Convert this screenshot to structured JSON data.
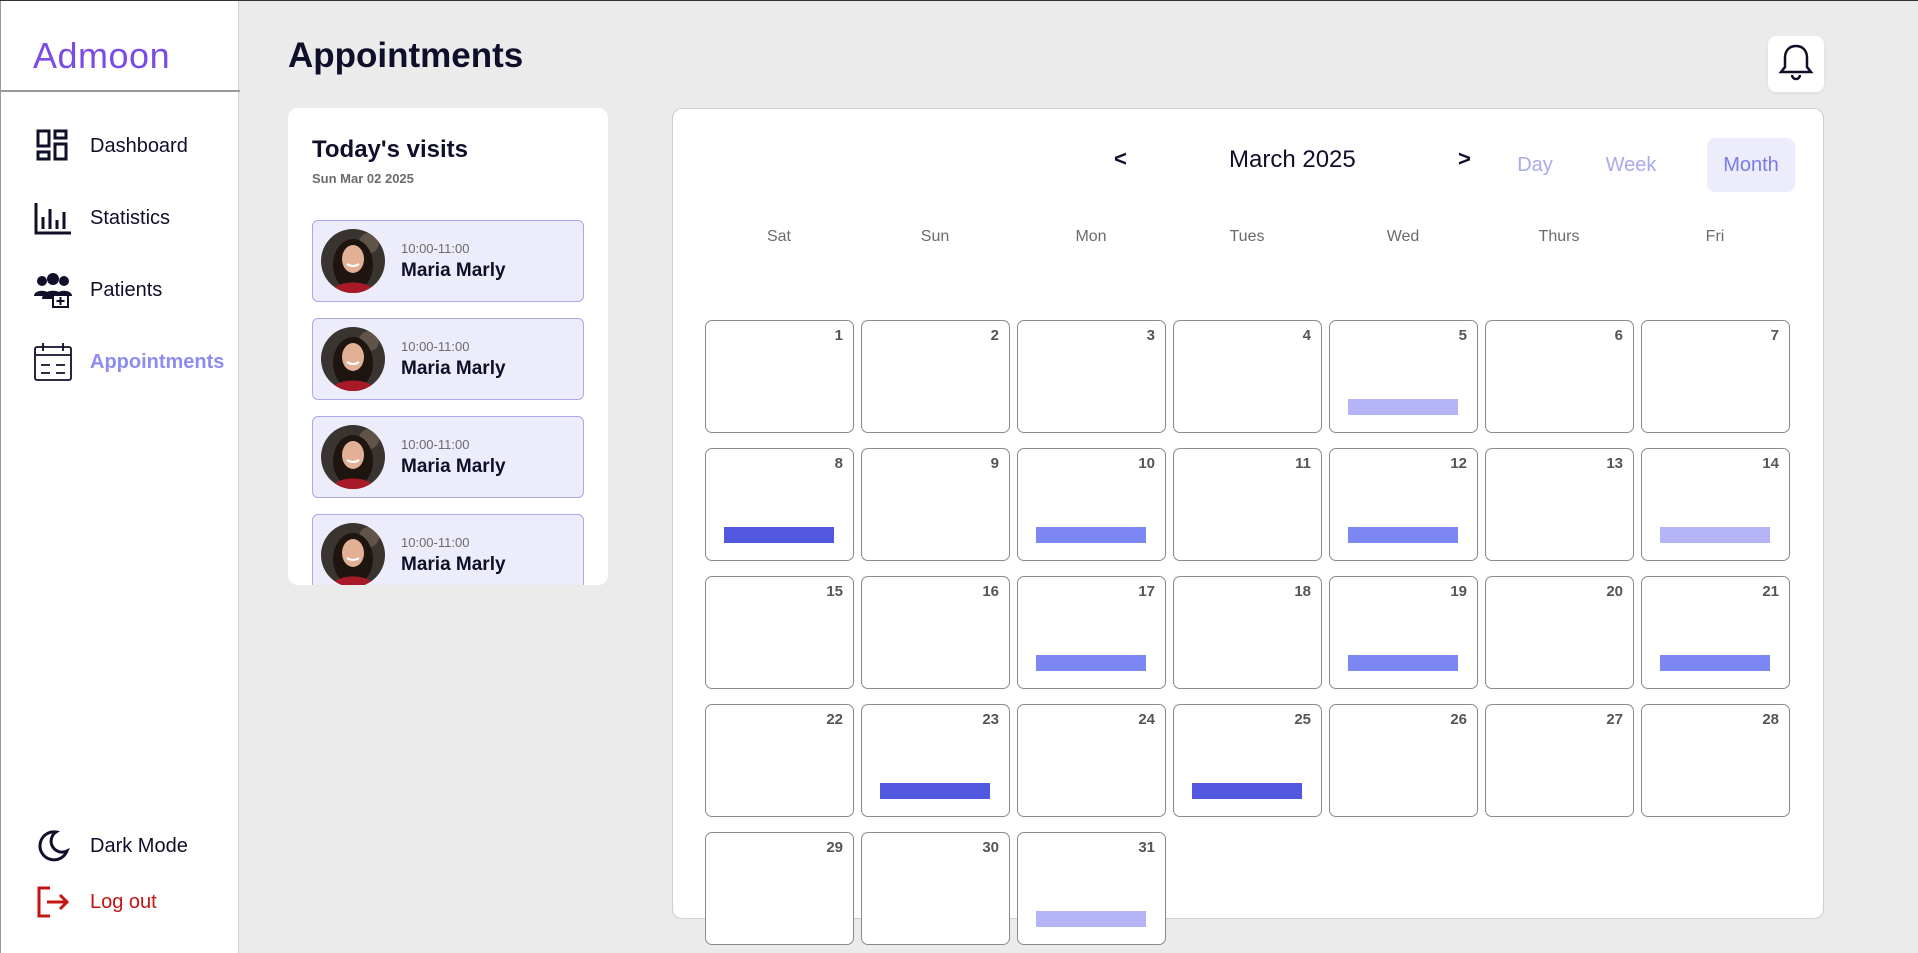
{
  "app": {
    "name": "Admoon"
  },
  "sidebar": {
    "items": [
      {
        "label": "Dashboard",
        "icon": "dashboard-icon"
      },
      {
        "label": "Statistics",
        "icon": "bar-chart-icon"
      },
      {
        "label": "Patients",
        "icon": "patients-icon"
      },
      {
        "label": "Appointments",
        "icon": "calendar-icon",
        "active": true
      }
    ],
    "bottom": [
      {
        "label": "Dark Mode",
        "icon": "moon-icon"
      },
      {
        "label": "Log out",
        "icon": "logout-icon"
      }
    ]
  },
  "header": {
    "title": "Appointments",
    "bell_icon": "bell-icon"
  },
  "visits": {
    "title": "Today's visits",
    "date": "Sun Mar 02 2025",
    "items": [
      {
        "time": "10:00-11:00",
        "name": "Maria Marly"
      },
      {
        "time": "10:00-11:00",
        "name": "Maria Marly"
      },
      {
        "time": "10:00-11:00",
        "name": "Maria Marly"
      },
      {
        "time": "10:00-11:00",
        "name": "Maria Marly"
      }
    ]
  },
  "calendar": {
    "month_label": "March 2025",
    "prev": "<",
    "next": ">",
    "views": {
      "day": "Day",
      "week": "Week",
      "month": "Month"
    },
    "active_view": "Month",
    "weekdays": [
      "Sat",
      "Sun",
      "Mon",
      "Tues",
      "Wed",
      "Thurs",
      "Fri"
    ],
    "days": [
      "1",
      "2",
      "3",
      "4",
      "5",
      "6",
      "7",
      "8",
      "9",
      "10",
      "11",
      "12",
      "13",
      "14",
      "15",
      "16",
      "17",
      "18",
      "19",
      "20",
      "21",
      "22",
      "23",
      "24",
      "25",
      "26",
      "27",
      "28",
      "29",
      "30",
      "31"
    ],
    "events": [
      {
        "day": 5,
        "level": "low"
      },
      {
        "day": 8,
        "level": "high"
      },
      {
        "day": 10,
        "level": "mid"
      },
      {
        "day": 12,
        "level": "mid"
      },
      {
        "day": 14,
        "level": "low"
      },
      {
        "day": 17,
        "level": "mid"
      },
      {
        "day": 19,
        "level": "mid"
      },
      {
        "day": 21,
        "level": "mid"
      },
      {
        "day": 23,
        "level": "high"
      },
      {
        "day": 25,
        "level": "high"
      },
      {
        "day": 31,
        "level": "low"
      }
    ],
    "colors": {
      "high": "#5257df",
      "mid": "#7b86f2",
      "low": "#b4b4f6"
    }
  },
  "theme": {
    "accent": "#7a4be6",
    "active_nav": "#8c8cf3",
    "logout": "#c41414"
  }
}
